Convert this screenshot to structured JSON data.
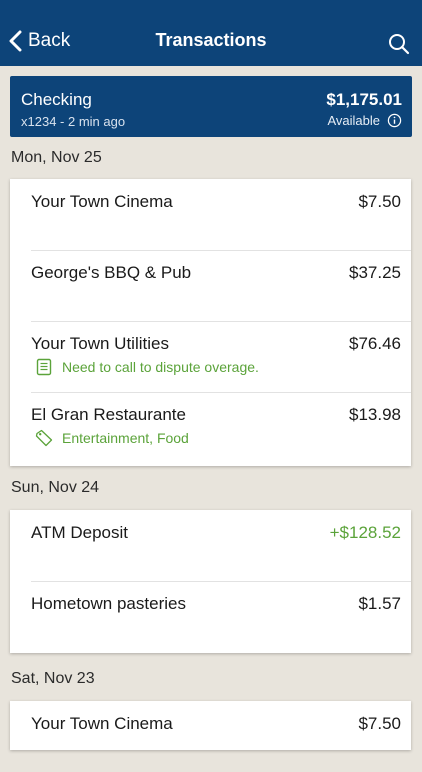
{
  "header": {
    "back_label": "Back",
    "title": "Transactions"
  },
  "account": {
    "name": "Checking",
    "subtitle": "x1234 - 2 min ago",
    "balance": "$1,175.01",
    "balance_label": "Available"
  },
  "days": [
    {
      "date": "Mon, Nov 25",
      "transactions": [
        {
          "name": "Your Town Cinema",
          "amount": "$7.50"
        },
        {
          "name": "George's BBQ & Pub",
          "amount": "$37.25"
        },
        {
          "name": "Your Town Utilities",
          "amount": "$76.46",
          "note": "Need to call to dispute overage.",
          "note_icon": "memo-icon"
        },
        {
          "name": "El Gran Restaurante",
          "amount": "$13.98",
          "note": "Entertainment, Food",
          "note_icon": "tag-icon"
        }
      ]
    },
    {
      "date": "Sun, Nov 24",
      "transactions": [
        {
          "name": "ATM Deposit",
          "amount": "+$128.52",
          "credit": true
        },
        {
          "name": "Hometown pasteries",
          "amount": "$1.57"
        }
      ]
    },
    {
      "date": "Sat, Nov 23",
      "transactions": [
        {
          "name": "Your Town Cinema",
          "amount": "$7.50"
        }
      ]
    }
  ],
  "colors": {
    "nav": "#0d4479",
    "credit": "#5ba33a",
    "background": "#e8e4dc"
  }
}
